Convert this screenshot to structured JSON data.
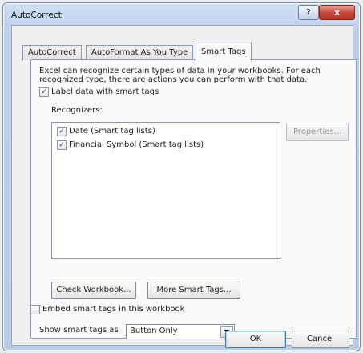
{
  "window": {
    "title": "AutoCorrect",
    "help_glyph": "?",
    "close_glyph": "x"
  },
  "tabs": [
    {
      "label": "AutoCorrect"
    },
    {
      "label": "AutoFormat As You Type"
    },
    {
      "label": "Smart Tags",
      "active": true
    }
  ],
  "smart_tags": {
    "intro": "Excel can recognize certain types of data in your workbooks.  For each recognized type, there are actions you can perform with that data.",
    "label_data": {
      "label": "Label data with smart tags",
      "checked": true
    },
    "recognizers_label": "Recognizers:",
    "recognizers": [
      {
        "label": "Date (Smart tag lists)",
        "checked": true
      },
      {
        "label": "Financial Symbol (Smart tag lists)",
        "checked": true
      }
    ],
    "properties_button": "Properties...",
    "check_workbook_button": "Check Workbook...",
    "more_smart_tags_button": "More Smart Tags...",
    "show_as_label": "Show smart tags as",
    "show_as_value": "Button Only",
    "embed": {
      "label": "Embed smart tags in this workbook",
      "checked": false
    }
  },
  "footer": {
    "ok_label": "OK",
    "cancel_label": "Cancel"
  },
  "icons": {
    "check": "✓",
    "dropdown": "▼"
  }
}
